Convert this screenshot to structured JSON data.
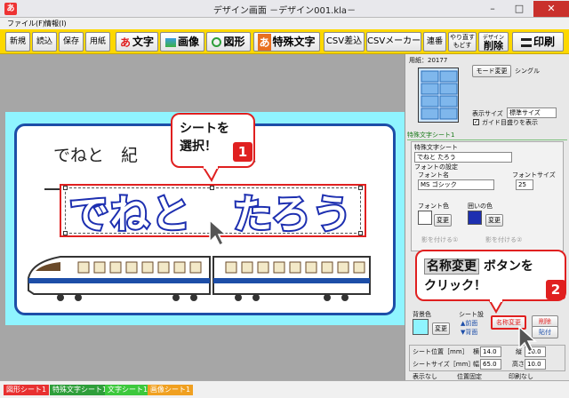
{
  "window": {
    "title": "デザイン画面 －デザイン001.kla－",
    "app_icon": "あ"
  },
  "window_controls": {
    "minimize": "–",
    "maximize": "□",
    "close": "✕"
  },
  "menu": [
    {
      "label": "ファイル(F)"
    },
    {
      "label": "情報(I)"
    }
  ],
  "toolbar": {
    "new": "新規",
    "load": "読込",
    "save": "保存",
    "paper": "用紙",
    "text_icon": "あ",
    "text": "文字",
    "image": "画像",
    "shape": "図形",
    "special_icon": "あ",
    "special_text": "特殊文字",
    "csv_insert": "CSV差込",
    "csv_maker": "CSVメーカー",
    "tile": "連番",
    "redo": "やり直す",
    "undo": "もどす",
    "delete_top": "デザイン",
    "delete": "削除",
    "print": "印刷"
  },
  "canvas": {
    "card_top_text": "でねと　紀　　　　ぞう組",
    "name_text": "でねと　たろう",
    "callout1": {
      "number": "1",
      "line1": "シートを",
      "line2": "選択！"
    }
  },
  "right_panel": {
    "paper_label": "用紙：20177",
    "mode_button": "モード変更",
    "mode_value": "シングル",
    "display_size_label": "表示サイズ",
    "display_size_value": "標準サイズ",
    "guide_checkbox": "ガイド目盛りを表示",
    "section_title": "特殊文字シート1",
    "sheet_label": "特殊文字シート",
    "sheet_value": "でねと たろう",
    "font_settings": "フォントの設定",
    "font_name_label": "フォント名",
    "font_name_value": "MS ゴシック",
    "font_size_label": "フォントサイズ",
    "font_size_value": "25",
    "font_color_label": "フォント色",
    "border_color_label": "囲いの色",
    "change": "変更",
    "shadow1": "影を付ける①",
    "shadow2": "影を付ける②",
    "bg_color_label": "背景色",
    "sheet_settings_label": "シート設",
    "front": "▲前面",
    "back": "▼背面",
    "rename_button": "名称変更",
    "delete_button": "削除",
    "paste_button": "貼付",
    "sheet_pos_label": "シート位置［mm］",
    "horiz": "横",
    "horiz_val": "14.0",
    "vert": "縦",
    "vert_val": "10.0",
    "sheet_size_label": "シートサイズ［mm］",
    "width": "幅",
    "width_val": "65.0",
    "height": "高さ",
    "height_val": "10.0",
    "hide": "表示なし",
    "lock": "位置固定",
    "no_print": "印刷なし"
  },
  "callout2": {
    "number": "2",
    "key": "名称変更",
    "line1": "ボタンを",
    "line2": "クリック！"
  },
  "status_tabs": [
    {
      "label": "図形シート1",
      "color": "#e83030"
    },
    {
      "label": "特殊文字シート1",
      "color": "#2e9e3a"
    },
    {
      "label": "文字シート1",
      "color": "#3cc83c"
    },
    {
      "label": "画像シート1",
      "color": "#f0a020"
    }
  ],
  "colors": {
    "toolbar": "#fdd800",
    "accent_red": "#e02020",
    "name_stroke": "#1d2fb0",
    "sheet_bg": "#8ff4ff"
  }
}
